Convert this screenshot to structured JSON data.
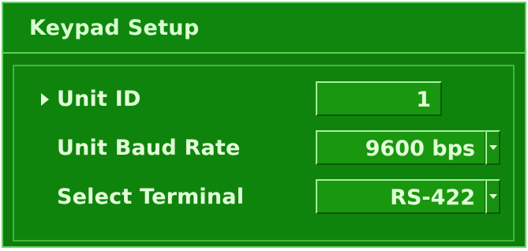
{
  "window": {
    "title": "Keypad Setup"
  },
  "fields": [
    {
      "label": "Unit ID",
      "value": "1",
      "selected": true,
      "control": "numeric-input"
    },
    {
      "label": "Unit Baud Rate",
      "value": "9600 bps",
      "selected": false,
      "control": "dropdown"
    },
    {
      "label": "Select Terminal",
      "value": "RS-422",
      "selected": false,
      "control": "dropdown"
    }
  ],
  "icons": {
    "selection_cursor": "play-arrow-icon",
    "dropdown": "chevron-down-icon"
  },
  "colors": {
    "panel_background": "#0e7d0c",
    "field_background": "#18970f",
    "text": "#e3ffd9",
    "highlight_border": "#a7f09c"
  }
}
